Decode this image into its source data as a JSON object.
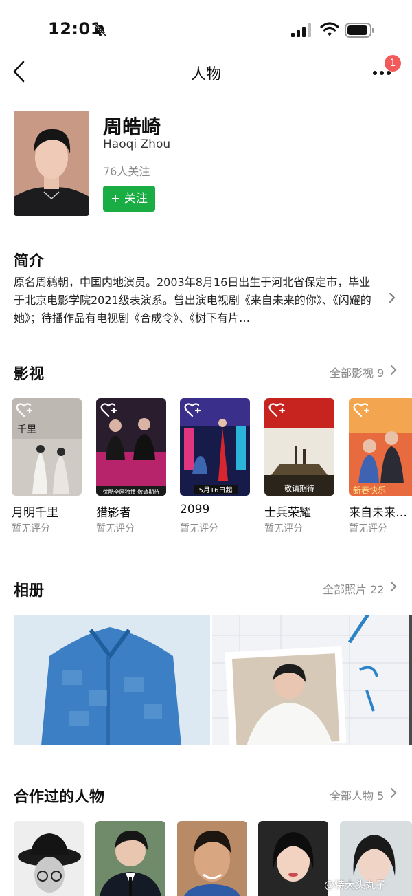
{
  "status_bar": {
    "time": "12:01"
  },
  "nav": {
    "title": "人物",
    "badge": "1"
  },
  "profile": {
    "name": "周皓崎",
    "english_name": "Haoqi Zhou",
    "followers": "76人关注",
    "follow_button": "+ 关注"
  },
  "intro": {
    "title": "简介",
    "text": "原名周鸫朝，中国内地演员。2003年8月16日出生于河北省保定市，毕业于北京电影学院2021级表演系。曾出演电视剧《来自未来的你》、《闪耀的她》；待播作品有电视剧《合成令》、《树下有片…"
  },
  "films": {
    "title": "影视",
    "more": "全部影视 9",
    "items": [
      {
        "title": "月明千里",
        "rating": "暂无评分",
        "poster_text": "千里"
      },
      {
        "title": "猎影者",
        "rating": "暂无评分",
        "poster_text": "优酷全网独播 敬请期待"
      },
      {
        "title": "2099",
        "rating": "暂无评分",
        "poster_text": "5月16日起"
      },
      {
        "title": "士兵荣耀",
        "rating": "暂无评分",
        "poster_text": "敬请期待"
      },
      {
        "title": "来自未来…",
        "rating": "暂无评分",
        "poster_text": "新春快乐"
      }
    ]
  },
  "album": {
    "title": "相册",
    "more": "全部照片 22"
  },
  "collaborators": {
    "title": "合作过的人物",
    "more": "全部人物 5"
  },
  "watermark": "@特大头丸子"
}
